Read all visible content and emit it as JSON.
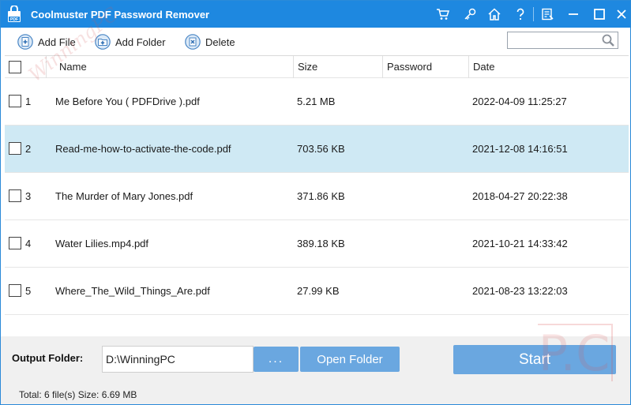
{
  "window": {
    "title": "Coolmuster PDF Password Remover",
    "app_icon_text": "PDF",
    "title_icons": [
      "cart-icon",
      "key-icon",
      "home-icon",
      "help-icon",
      "feedback-icon",
      "minimize-icon",
      "maximize-icon",
      "close-icon"
    ]
  },
  "toolbar": {
    "add_file": "Add File",
    "add_folder": "Add Folder",
    "delete": "Delete",
    "search_value": ""
  },
  "table": {
    "columns": [
      "Name",
      "Size",
      "Password",
      "Date"
    ],
    "rows": [
      {
        "index": "1",
        "name": "Me Before You ( PDFDrive ).pdf",
        "size": "5.21 MB",
        "password": "",
        "date": "2022-04-09 11:25:27",
        "selected": false
      },
      {
        "index": "2",
        "name": "Read-me-how-to-activate-the-code.pdf",
        "size": "703.56 KB",
        "password": "",
        "date": "2021-12-08 14:16:51",
        "selected": true
      },
      {
        "index": "3",
        "name": "The Murder of Mary Jones.pdf",
        "size": "371.86 KB",
        "password": "",
        "date": "2018-04-27 20:22:38",
        "selected": false
      },
      {
        "index": "4",
        "name": "Water Lilies.mp4.pdf",
        "size": "389.18 KB",
        "password": "",
        "date": "2021-10-21 14:33:42",
        "selected": false
      },
      {
        "index": "5",
        "name": "Where_The_Wild_Things_Are.pdf",
        "size": "27.99 KB",
        "password": "",
        "date": "2021-08-23 13:22:03",
        "selected": false
      }
    ]
  },
  "output": {
    "label": "Output Folder:",
    "path": "D:\\WinningPC",
    "browse_label": "...",
    "open_folder_label": "Open Folder",
    "start_label": "Start"
  },
  "status": {
    "text": "Total: 6 file(s) Size: 6.69 MB"
  },
  "watermark": {
    "text": "WinningPC",
    "logo_text": "P.C"
  },
  "colors": {
    "titlebar": "#1e88e0",
    "selected_row": "#cfe9f4",
    "button": "#6aa7e0",
    "bottom_panel": "#f0f0f0"
  }
}
